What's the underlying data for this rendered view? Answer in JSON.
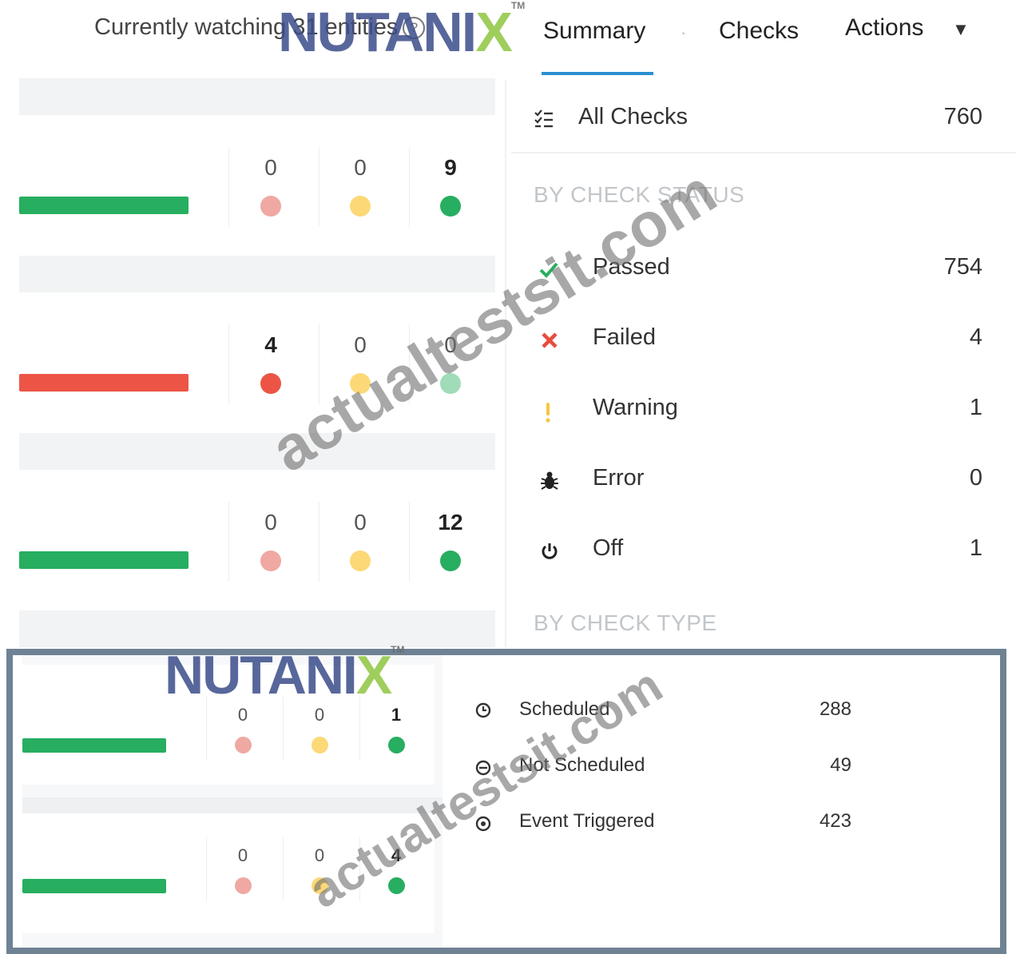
{
  "header": {
    "watching_text": "Currently watching 31 entities",
    "info_glyph": "?",
    "tabs": {
      "summary": "Summary",
      "checks": "Checks",
      "actions": "Actions"
    }
  },
  "colors": {
    "green": "#27ae60",
    "red": "#ec5446",
    "pale_red": "#f0a8a2",
    "pale_yellow": "#fcd877",
    "accent_blue": "#2a8fd2",
    "frame": "#6f8294",
    "logo_blue": "#3b4d8a",
    "logo_green": "#8fc641"
  },
  "rows": [
    {
      "bar_status": "green",
      "critical": "0",
      "warning": "0",
      "passed": "9"
    },
    {
      "bar_status": "red",
      "critical": "4",
      "warning": "0",
      "passed": "0"
    },
    {
      "bar_status": "green",
      "critical": "0",
      "warning": "0",
      "passed": "12"
    },
    {
      "bar_status": "green",
      "critical": "0",
      "warning": "0",
      "passed": "1"
    },
    {
      "bar_status": "green",
      "critical": "0",
      "warning": "0",
      "passed": "4"
    }
  ],
  "summary": {
    "all_checks": {
      "label": "All Checks",
      "count": "760",
      "icon": "list-check-icon"
    },
    "by_status_title": "BY CHECK STATUS",
    "status": [
      {
        "label": "Passed",
        "count": "754",
        "icon": "check-icon"
      },
      {
        "label": "Failed",
        "count": "4",
        "icon": "x-icon"
      },
      {
        "label": "Warning",
        "count": "1",
        "icon": "warning-icon"
      },
      {
        "label": "Error",
        "count": "0",
        "icon": "bug-icon"
      },
      {
        "label": "Off",
        "count": "1",
        "icon": "power-icon"
      }
    ],
    "by_type_title": "BY CHECK TYPE",
    "types": [
      {
        "label": "Scheduled",
        "count": "288",
        "icon": "clock-icon"
      },
      {
        "label": "Not Scheduled",
        "count": "49",
        "icon": "clock-off-icon"
      },
      {
        "label": "Event Triggered",
        "count": "423",
        "icon": "event-icon"
      }
    ]
  },
  "branding": {
    "logo_main": "NUTANI",
    "logo_x": "X",
    "logo_tm": "TM",
    "watermark": "actualtestsit.com"
  }
}
